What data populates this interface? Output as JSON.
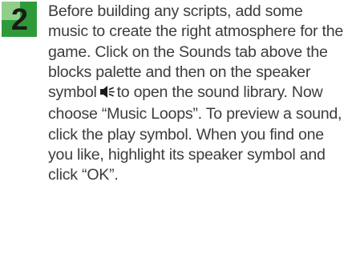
{
  "step": {
    "number": "2",
    "text_before_icon": "Before building any scripts, add some music to create the right atmosphere for the game. Click on the Sounds tab above the blocks palette and then on the speaker symbol",
    "icon": "speaker-icon",
    "text_after_icon": "to open the sound library. Now choose “Music Loops”. To preview a sound, click the play symbol. When you find one you like, highlight its speaker symbol and click “OK”."
  },
  "colors": {
    "badge_dark": "#2f9a3a",
    "badge_light": "#8fcf8a",
    "text": "#3c3c3c"
  }
}
